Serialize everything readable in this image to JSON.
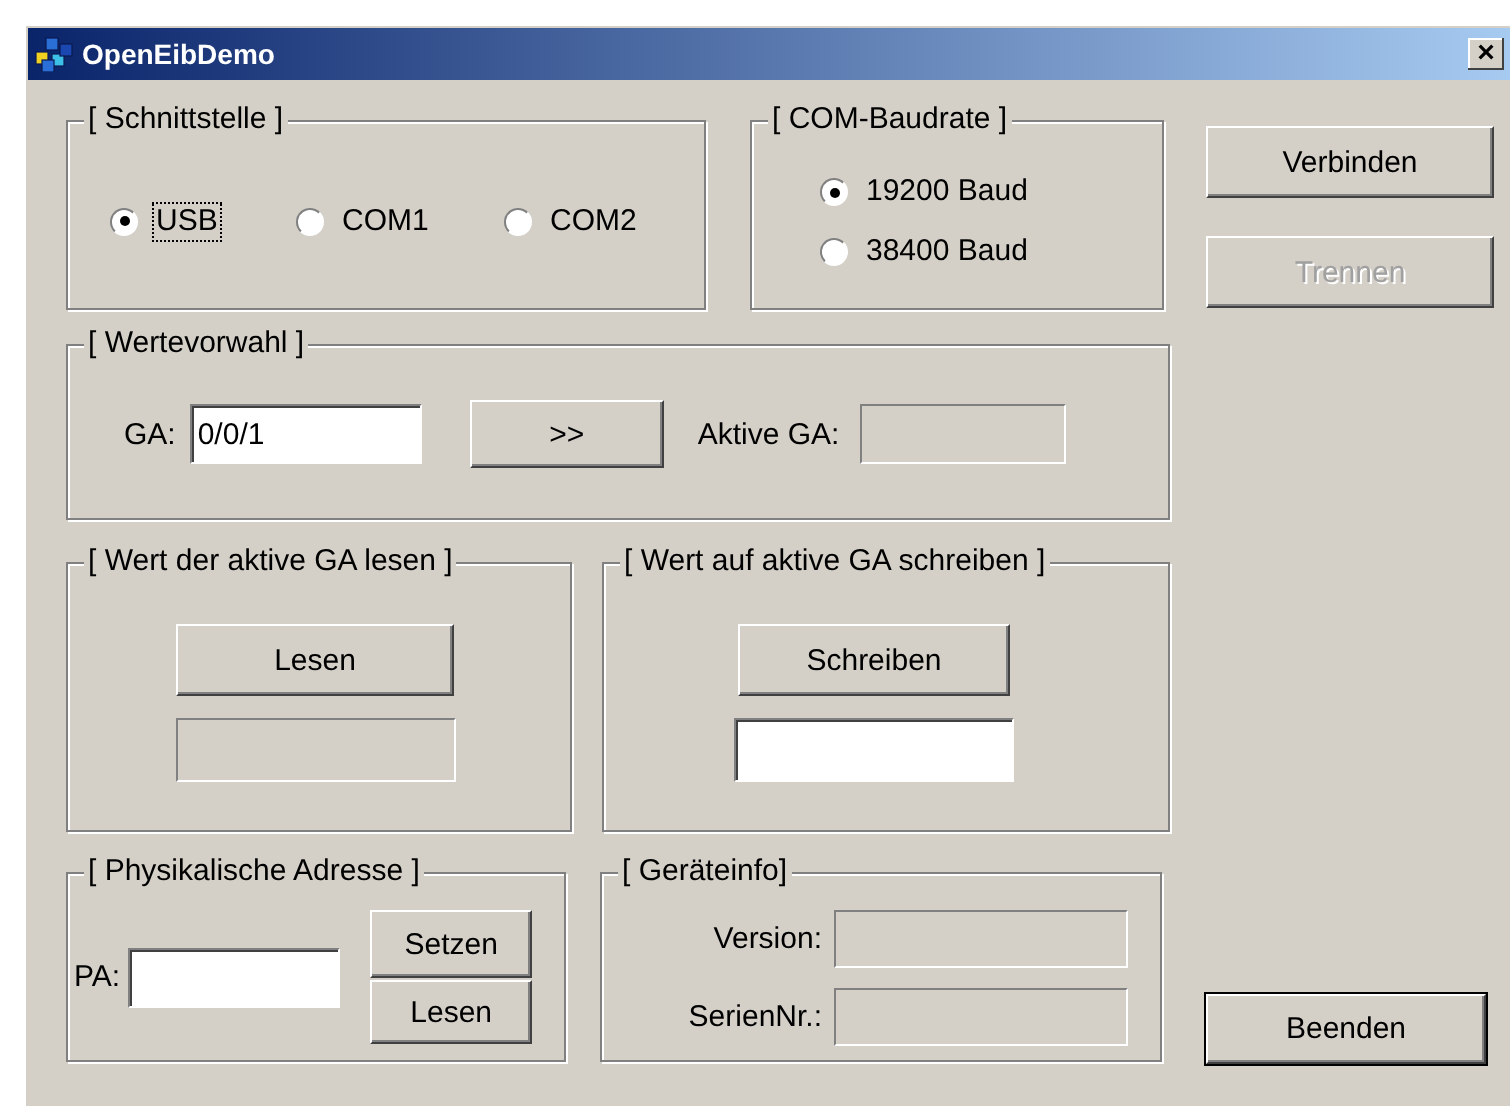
{
  "window": {
    "title": "OpenEibDemo",
    "close": "×"
  },
  "interface": {
    "title": "[ Schnittstelle ]",
    "options": [
      {
        "label": "USB",
        "selected": true,
        "focused": true
      },
      {
        "label": "COM1",
        "selected": false,
        "focused": false
      },
      {
        "label": "COM2",
        "selected": false,
        "focused": false
      }
    ]
  },
  "baud_rate": {
    "title": "[ COM-Baudrate ]",
    "options": [
      {
        "label": "19200 Baud",
        "selected": true
      },
      {
        "label": "38400 Baud",
        "selected": false
      }
    ]
  },
  "connect_button": {
    "label": "Verbinden",
    "disabled": false
  },
  "disconnect_button": {
    "label": "Trennen",
    "disabled": true
  },
  "value_selection": {
    "title": "[ Wertevorwahl ]",
    "ga_label": "GA:",
    "ga_value": "0/0/1",
    "apply_button": ">>",
    "active_ga_label": "Aktive GA:",
    "active_ga_disabled": true
  },
  "read_group": {
    "title": "[ Wert der aktive GA lesen ]",
    "button": "Lesen",
    "result_disabled": true
  },
  "write_group": {
    "title": "[ Wert auf aktive GA schreiben ]",
    "button": "Schreiben",
    "value_disabled": false
  },
  "physical_address": {
    "title": "[ Physikalische Adresse ]",
    "label": "PA:",
    "set_button": "Setzen",
    "read_button": "Lesen"
  },
  "device_info": {
    "title": "[ Geräteinfo]",
    "fields": [
      {
        "label": "Version:",
        "disabled": true
      },
      {
        "label": "SerienNr.:",
        "disabled": true
      }
    ]
  },
  "exit_button": {
    "label": "Beenden",
    "default": true
  }
}
